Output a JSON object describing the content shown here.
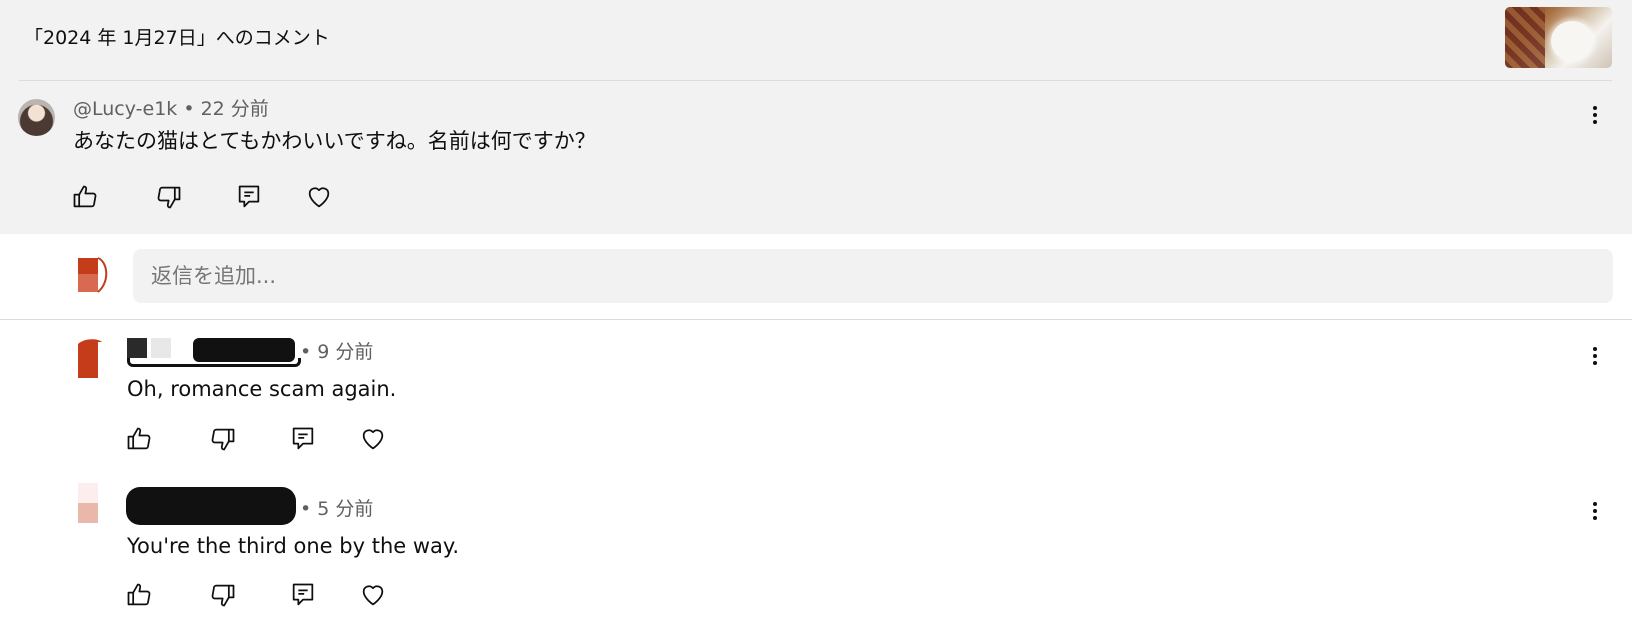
{
  "header": {
    "title": "「2024 年 1月27日」へのコメント",
    "thumbnail": "cat-video-thumbnail"
  },
  "original_comment": {
    "author": "@Lucy-e1k",
    "time": "• 22 分前",
    "text": "あなたの猫はとてもかわいいですね。名前は何ですか？"
  },
  "reply_input": {
    "placeholder": "返信を追加..."
  },
  "replies": [
    {
      "author": "",
      "time": "• 9 分前",
      "text": "Oh, romance scam again."
    },
    {
      "author": "",
      "time": "• 5 分前",
      "text": "You're the third one by the way."
    }
  ],
  "icons": [
    "like-icon",
    "dislike-icon",
    "reply-icon",
    "heart-icon",
    "more-options-icon"
  ],
  "colors": {
    "header_bg": "#f2f2f2",
    "meta_text": "#606060",
    "avatar_red": "#c43c1a"
  }
}
